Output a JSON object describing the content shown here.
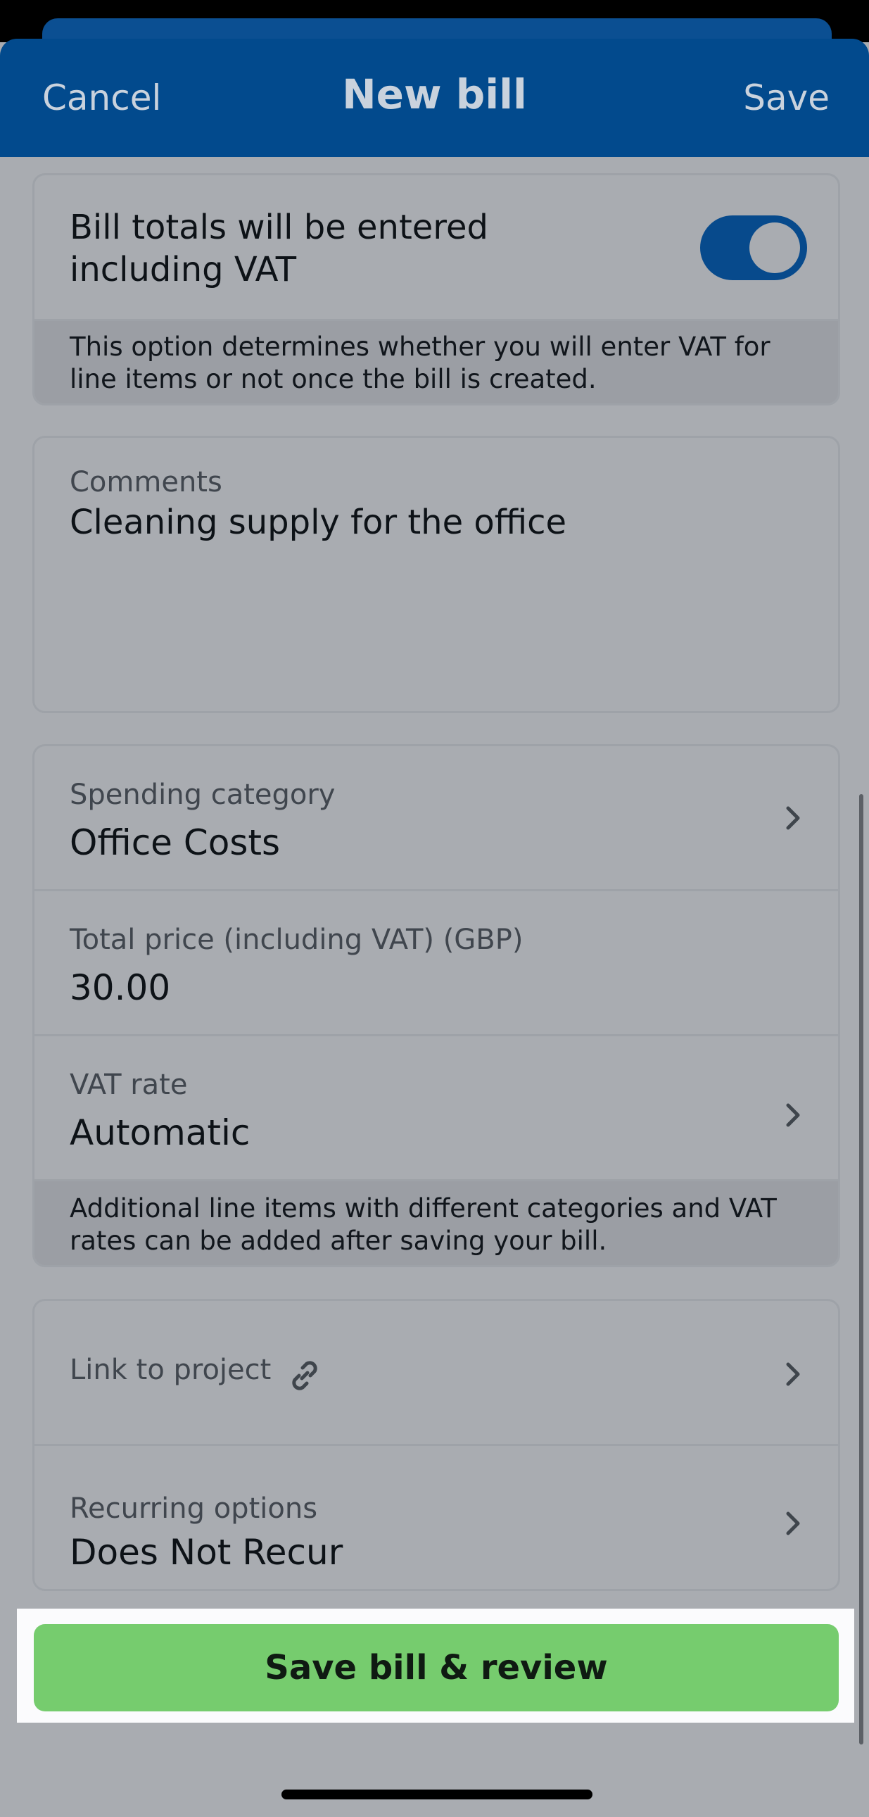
{
  "header": {
    "cancel_label": "Cancel",
    "title": "New bill",
    "save_label": "Save"
  },
  "vat_card": {
    "toggle_label": "Bill totals will be entered including VAT",
    "toggle_on": true,
    "note": "This option determines whether you will enter VAT for line items or not once the bill is created."
  },
  "comments": {
    "label": "Comments",
    "value": "Cleaning supply for the office"
  },
  "details": {
    "category_label": "Spending category",
    "category_value": "Office Costs",
    "total_label": "Total price (including VAT) (GBP)",
    "total_value": "30.00",
    "vat_label": "VAT rate",
    "vat_value": "Automatic",
    "note": "Additional line items with different categories and VAT rates can be added after saving your bill."
  },
  "options": {
    "project_label": "Link to project",
    "recurring_label": "Recurring options",
    "recurring_value": "Does Not Recur"
  },
  "cta": {
    "label": "Save bill & review"
  },
  "colors": {
    "header": "#024a8d",
    "cta": "#76cc6e",
    "toggle": "#074a8c"
  },
  "icons": [
    "chevron-right-icon",
    "link-icon"
  ]
}
